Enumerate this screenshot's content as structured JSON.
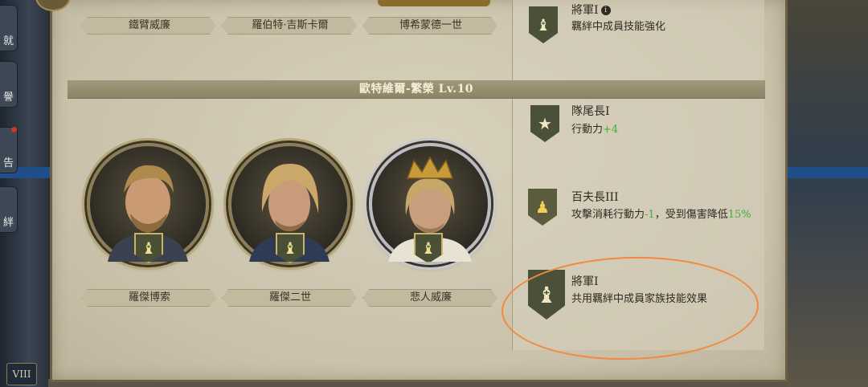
{
  "left_sidebar": {
    "tabs": [
      "就",
      "譽",
      "告",
      "絆"
    ],
    "roman_badge": "VIII"
  },
  "top_row_names": [
    "鐵臂威廉",
    "羅伯特·吉斯卡爾",
    "博希蒙德一世"
  ],
  "top_rank": {
    "title": "將軍I",
    "info": "i",
    "desc": "羈絆中成員技能強化"
  },
  "section": {
    "title": "歐特維爾-繁榮 Lv.10"
  },
  "members": [
    {
      "name": "羅傑博索",
      "badge_icon": "♝"
    },
    {
      "name": "羅傑二世",
      "badge_icon": "♝"
    },
    {
      "name": "悲人威廉",
      "badge_icon": "♝"
    }
  ],
  "ranks": [
    {
      "title": "隊尾長I",
      "icon": "★",
      "desc_prefix": "行動力",
      "desc_value1": "+4",
      "desc_mid": "",
      "desc_value2": ""
    },
    {
      "title": "百夫長III",
      "icon": "♟",
      "desc_prefix": "攻擊消耗行動力",
      "desc_value1": "-1",
      "desc_mid": "，受到傷害降低",
      "desc_value2": "15%"
    },
    {
      "title": "將軍I",
      "icon": "♝",
      "desc_prefix": "共用羈絆中成員家族技能效果",
      "desc_value1": "",
      "desc_mid": "",
      "desc_value2": ""
    }
  ],
  "colors": {
    "panel": "#cdc6b1",
    "annotation": "#f28a3d",
    "positive": "#3fae3a"
  }
}
